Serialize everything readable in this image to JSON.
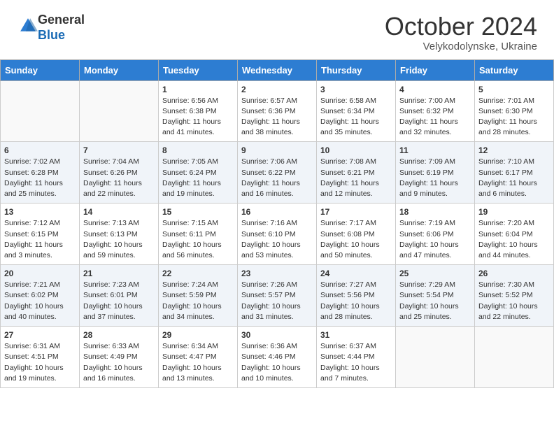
{
  "header": {
    "logo_general": "General",
    "logo_blue": "Blue",
    "month_title": "October 2024",
    "location": "Velykodolynske, Ukraine"
  },
  "weekdays": [
    "Sunday",
    "Monday",
    "Tuesday",
    "Wednesday",
    "Thursday",
    "Friday",
    "Saturday"
  ],
  "weeks": [
    [
      {
        "day": "",
        "content": ""
      },
      {
        "day": "",
        "content": ""
      },
      {
        "day": "1",
        "content": "Sunrise: 6:56 AM\nSunset: 6:38 PM\nDaylight: 11 hours and 41 minutes."
      },
      {
        "day": "2",
        "content": "Sunrise: 6:57 AM\nSunset: 6:36 PM\nDaylight: 11 hours and 38 minutes."
      },
      {
        "day": "3",
        "content": "Sunrise: 6:58 AM\nSunset: 6:34 PM\nDaylight: 11 hours and 35 minutes."
      },
      {
        "day": "4",
        "content": "Sunrise: 7:00 AM\nSunset: 6:32 PM\nDaylight: 11 hours and 32 minutes."
      },
      {
        "day": "5",
        "content": "Sunrise: 7:01 AM\nSunset: 6:30 PM\nDaylight: 11 hours and 28 minutes."
      }
    ],
    [
      {
        "day": "6",
        "content": "Sunrise: 7:02 AM\nSunset: 6:28 PM\nDaylight: 11 hours and 25 minutes."
      },
      {
        "day": "7",
        "content": "Sunrise: 7:04 AM\nSunset: 6:26 PM\nDaylight: 11 hours and 22 minutes."
      },
      {
        "day": "8",
        "content": "Sunrise: 7:05 AM\nSunset: 6:24 PM\nDaylight: 11 hours and 19 minutes."
      },
      {
        "day": "9",
        "content": "Sunrise: 7:06 AM\nSunset: 6:22 PM\nDaylight: 11 hours and 16 minutes."
      },
      {
        "day": "10",
        "content": "Sunrise: 7:08 AM\nSunset: 6:21 PM\nDaylight: 11 hours and 12 minutes."
      },
      {
        "day": "11",
        "content": "Sunrise: 7:09 AM\nSunset: 6:19 PM\nDaylight: 11 hours and 9 minutes."
      },
      {
        "day": "12",
        "content": "Sunrise: 7:10 AM\nSunset: 6:17 PM\nDaylight: 11 hours and 6 minutes."
      }
    ],
    [
      {
        "day": "13",
        "content": "Sunrise: 7:12 AM\nSunset: 6:15 PM\nDaylight: 11 hours and 3 minutes."
      },
      {
        "day": "14",
        "content": "Sunrise: 7:13 AM\nSunset: 6:13 PM\nDaylight: 10 hours and 59 minutes."
      },
      {
        "day": "15",
        "content": "Sunrise: 7:15 AM\nSunset: 6:11 PM\nDaylight: 10 hours and 56 minutes."
      },
      {
        "day": "16",
        "content": "Sunrise: 7:16 AM\nSunset: 6:10 PM\nDaylight: 10 hours and 53 minutes."
      },
      {
        "day": "17",
        "content": "Sunrise: 7:17 AM\nSunset: 6:08 PM\nDaylight: 10 hours and 50 minutes."
      },
      {
        "day": "18",
        "content": "Sunrise: 7:19 AM\nSunset: 6:06 PM\nDaylight: 10 hours and 47 minutes."
      },
      {
        "day": "19",
        "content": "Sunrise: 7:20 AM\nSunset: 6:04 PM\nDaylight: 10 hours and 44 minutes."
      }
    ],
    [
      {
        "day": "20",
        "content": "Sunrise: 7:21 AM\nSunset: 6:02 PM\nDaylight: 10 hours and 40 minutes."
      },
      {
        "day": "21",
        "content": "Sunrise: 7:23 AM\nSunset: 6:01 PM\nDaylight: 10 hours and 37 minutes."
      },
      {
        "day": "22",
        "content": "Sunrise: 7:24 AM\nSunset: 5:59 PM\nDaylight: 10 hours and 34 minutes."
      },
      {
        "day": "23",
        "content": "Sunrise: 7:26 AM\nSunset: 5:57 PM\nDaylight: 10 hours and 31 minutes."
      },
      {
        "day": "24",
        "content": "Sunrise: 7:27 AM\nSunset: 5:56 PM\nDaylight: 10 hours and 28 minutes."
      },
      {
        "day": "25",
        "content": "Sunrise: 7:29 AM\nSunset: 5:54 PM\nDaylight: 10 hours and 25 minutes."
      },
      {
        "day": "26",
        "content": "Sunrise: 7:30 AM\nSunset: 5:52 PM\nDaylight: 10 hours and 22 minutes."
      }
    ],
    [
      {
        "day": "27",
        "content": "Sunrise: 6:31 AM\nSunset: 4:51 PM\nDaylight: 10 hours and 19 minutes."
      },
      {
        "day": "28",
        "content": "Sunrise: 6:33 AM\nSunset: 4:49 PM\nDaylight: 10 hours and 16 minutes."
      },
      {
        "day": "29",
        "content": "Sunrise: 6:34 AM\nSunset: 4:47 PM\nDaylight: 10 hours and 13 minutes."
      },
      {
        "day": "30",
        "content": "Sunrise: 6:36 AM\nSunset: 4:46 PM\nDaylight: 10 hours and 10 minutes."
      },
      {
        "day": "31",
        "content": "Sunrise: 6:37 AM\nSunset: 4:44 PM\nDaylight: 10 hours and 7 minutes."
      },
      {
        "day": "",
        "content": ""
      },
      {
        "day": "",
        "content": ""
      }
    ]
  ]
}
